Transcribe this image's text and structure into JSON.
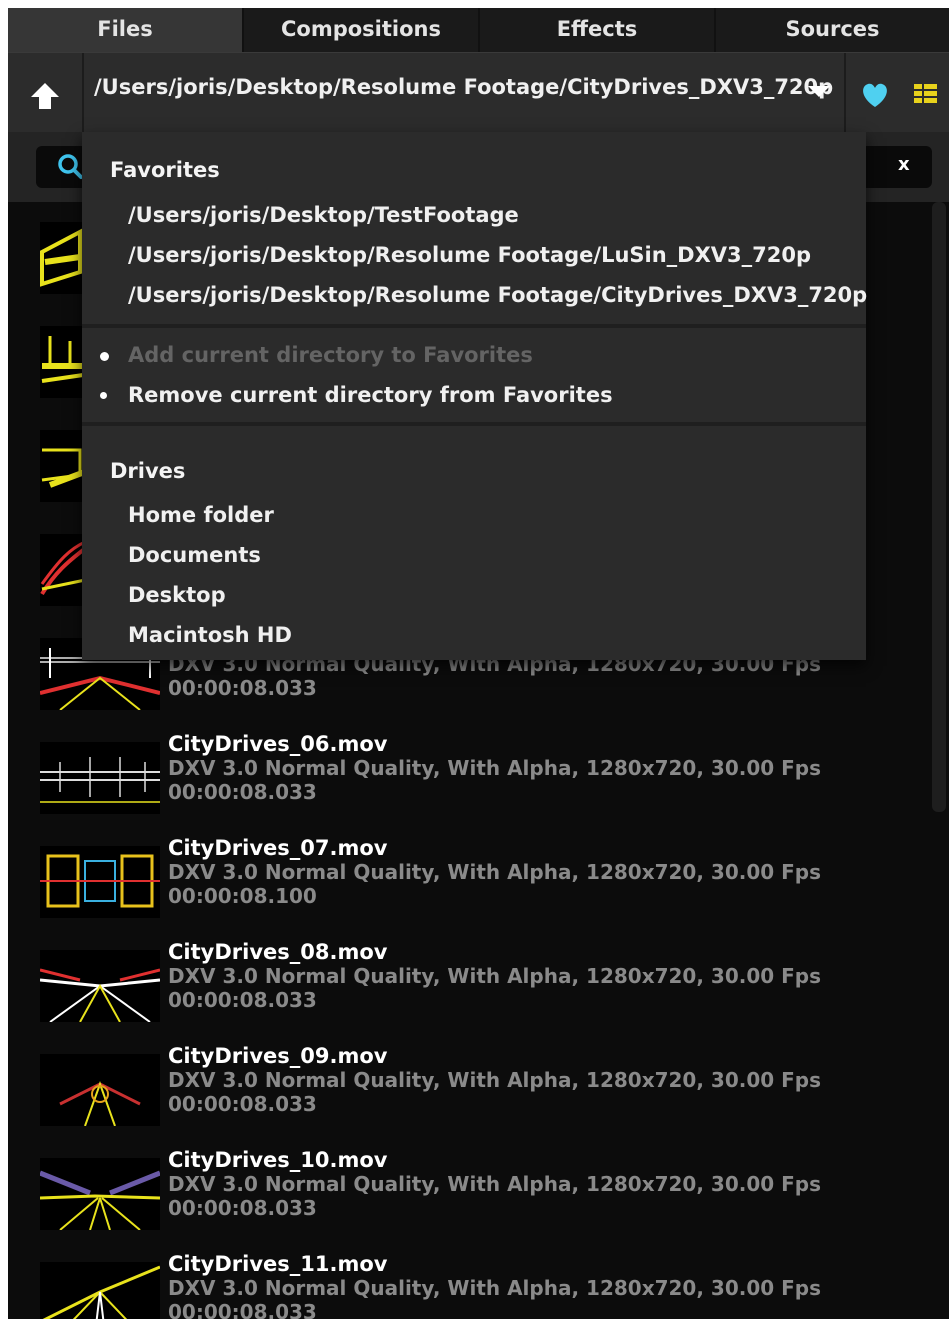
{
  "tabs": [
    {
      "label": "Files",
      "active": true
    },
    {
      "label": "Compositions",
      "active": false
    },
    {
      "label": "Effects",
      "active": false
    },
    {
      "label": "Sources",
      "active": false
    }
  ],
  "path": "/Users/joris/Desktop/Resolume Footage/CityDrives_DXV3_720p",
  "search": {
    "clear_label": "x"
  },
  "dropdown": {
    "favorites_heading": "Favorites",
    "favorites": [
      "/Users/joris/Desktop/TestFootage",
      "/Users/joris/Desktop/Resolume Footage/LuSin_DXV3_720p",
      "/Users/joris/Desktop/Resolume Footage/CityDrives_DXV3_720p"
    ],
    "add_favorite": "Add current directory to Favorites",
    "remove_favorite": "Remove current directory from Favorites",
    "drives_heading": "Drives",
    "drives": [
      "Home folder",
      "Documents",
      "Desktop",
      "Macintosh HD"
    ]
  },
  "files": [
    {
      "name": "",
      "info": "DXV 3.0 Normal Quality, With Alpha, 1280x720, 30.00 Fps",
      "duration": "00:00:08.033"
    },
    {
      "name": "CityDrives_06.mov",
      "info": "DXV 3.0 Normal Quality, With Alpha, 1280x720, 30.00 Fps",
      "duration": "00:00:08.033"
    },
    {
      "name": "CityDrives_07.mov",
      "info": "DXV 3.0 Normal Quality, With Alpha, 1280x720, 30.00 Fps",
      "duration": "00:00:08.100"
    },
    {
      "name": "CityDrives_08.mov",
      "info": "DXV 3.0 Normal Quality, With Alpha, 1280x720, 30.00 Fps",
      "duration": "00:00:08.033"
    },
    {
      "name": "CityDrives_09.mov",
      "info": "DXV 3.0 Normal Quality, With Alpha, 1280x720, 30.00 Fps",
      "duration": "00:00:08.033"
    },
    {
      "name": "CityDrives_10.mov",
      "info": "DXV 3.0 Normal Quality, With Alpha, 1280x720, 30.00 Fps",
      "duration": "00:00:08.033"
    },
    {
      "name": "CityDrives_11.mov",
      "info": "DXV 3.0 Normal Quality, With Alpha, 1280x720, 30.00 Fps",
      "duration": "00:00:08.033"
    }
  ],
  "colors": {
    "accent_heart": "#4fd0f0",
    "grid_icon": "#e8d21c",
    "bg": "#0c0c0c",
    "panel": "#2b2b2b"
  }
}
